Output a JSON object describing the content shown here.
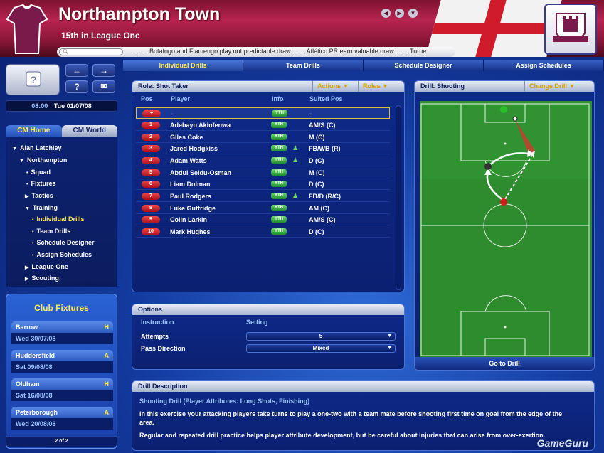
{
  "header": {
    "team_name": "Northampton Town",
    "league_position": "15th in League One",
    "search_placeholder": "",
    "ticker": ". . . . Botafogo and Flamengo play out predictable draw  . . . .  Atlético PR earn valuable draw  . . . .  Turne"
  },
  "sidebar": {
    "help_label": "?",
    "time": "08:00",
    "date": "Tue 01/07/08",
    "tabs": [
      "CM Home",
      "CM World"
    ],
    "tree": [
      {
        "label": "Alan Latchley",
        "arrow": "▼"
      },
      {
        "label": "Northampton",
        "arrow": "▼"
      },
      {
        "label": "Squad",
        "arrow": "•"
      },
      {
        "label": "Fixtures",
        "arrow": "•"
      },
      {
        "label": "Tactics",
        "arrow": "▶"
      },
      {
        "label": "Training",
        "arrow": "▼"
      },
      {
        "label": "Individual Drills",
        "arrow": "•"
      },
      {
        "label": "Team Drills",
        "arrow": "•"
      },
      {
        "label": "Schedule Designer",
        "arrow": "•"
      },
      {
        "label": "Assign Schedules",
        "arrow": "•"
      },
      {
        "label": "League One",
        "arrow": "▶"
      },
      {
        "label": "Scouting",
        "arrow": "▶"
      }
    ]
  },
  "fixtures": {
    "title": "Club Fixtures",
    "items": [
      {
        "team": "Barrow",
        "venue": "H",
        "date": "Wed 30/07/08"
      },
      {
        "team": "Huddersfield",
        "venue": "A",
        "date": "Sat 09/08/08"
      },
      {
        "team": "Oldham",
        "venue": "H",
        "date": "Sat 16/08/08"
      },
      {
        "team": "Peterborough",
        "venue": "A",
        "date": "Wed 20/08/08"
      }
    ],
    "pager": "2 of 2"
  },
  "main_tabs": [
    "Individual Drills",
    "Team Drills",
    "Schedule Designer",
    "Assign Schedules"
  ],
  "role_panel": {
    "title": "Role: Shot Taker",
    "actions": "Actions",
    "roles": "Roles",
    "columns": [
      "Pos",
      "Player",
      "Info",
      "Suited Pos"
    ],
    "rows": [
      {
        "pos": "+",
        "player": "-",
        "info": "YTH",
        "suited": "-"
      },
      {
        "pos": "1",
        "player": "Adebayo Akinfenwa",
        "info": "YTH",
        "suited": "AM/S (C)"
      },
      {
        "pos": "2",
        "player": "Giles Coke",
        "info": "YTH",
        "suited": "M (C)"
      },
      {
        "pos": "3",
        "player": "Jared Hodgkiss",
        "info": "YTH",
        "suited": "FB/WB (R)"
      },
      {
        "pos": "4",
        "player": "Adam Watts",
        "info": "YTH",
        "suited": "D (C)"
      },
      {
        "pos": "5",
        "player": "Abdul Seidu-Osman",
        "info": "YTH",
        "suited": "M (C)"
      },
      {
        "pos": "6",
        "player": "Liam Dolman",
        "info": "YTH",
        "suited": "D (C)"
      },
      {
        "pos": "7",
        "player": "Paul Rodgers",
        "info": "YTH",
        "suited": "FB/D (R/C)"
      },
      {
        "pos": "8",
        "player": "Luke Guttridge",
        "info": "YTH",
        "suited": "AM (C)"
      },
      {
        "pos": "9",
        "player": "Colin Larkin",
        "info": "YTH",
        "suited": "AM/S (C)"
      },
      {
        "pos": "10",
        "player": "Mark Hughes",
        "info": "YTH",
        "suited": "D (C)"
      }
    ]
  },
  "options": {
    "title": "Options",
    "col_instruction": "Instruction",
    "col_setting": "Setting",
    "items": [
      {
        "label": "Attempts",
        "value": "5"
      },
      {
        "label": "Pass Direction",
        "value": "Mixed"
      }
    ]
  },
  "drill_panel": {
    "title": "Drill: Shooting",
    "change": "Change Drill",
    "go": "Go to Drill"
  },
  "description": {
    "title": "Drill Description",
    "subtitle": "Shooting Drill (Player Attributes: Long Shots, Finishing)",
    "para1": "In this exercise your attacking players take turns to play a one-two with a team mate before shooting first time on goal from the edge of the area.",
    "para2": "Regular and repeated drill practice helps player attribute development, but be careful about injuries that can arise from over-exertion."
  },
  "watermark": "GameGuru",
  "colors": {
    "accent": "#ffea50",
    "header": "#b8244f",
    "panel": "#0e2a8a"
  }
}
